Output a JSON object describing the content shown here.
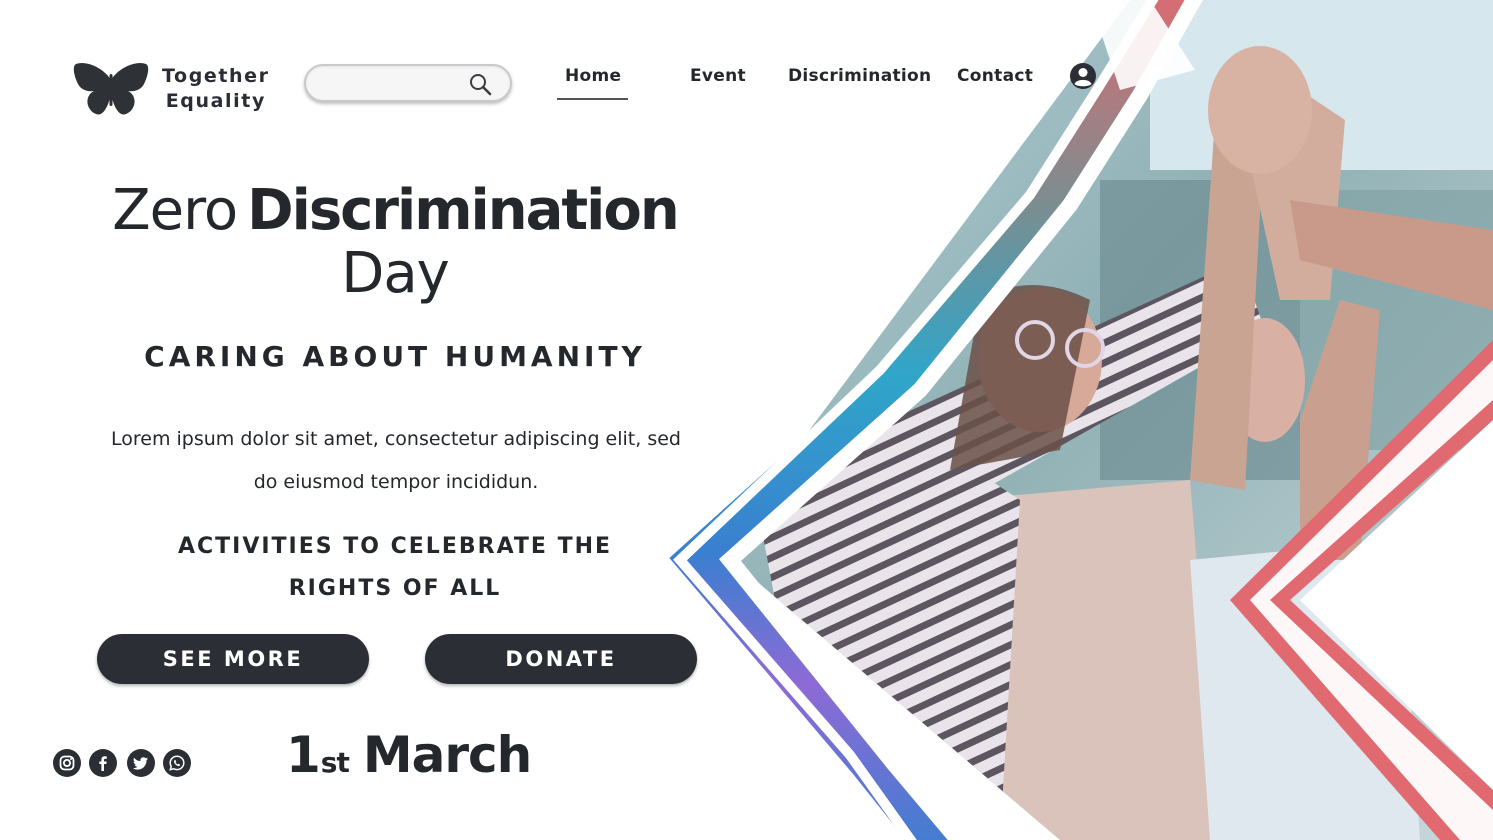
{
  "brand": {
    "line1": "Together",
    "line2": "Equality",
    "logo_icon": "butterfly-icon"
  },
  "search": {
    "placeholder": "",
    "value": "",
    "icon": "search-icon"
  },
  "nav": {
    "items": [
      {
        "label": "Home",
        "active": true
      },
      {
        "label": "Event",
        "active": false
      },
      {
        "label": "Discrimination",
        "active": false
      },
      {
        "label": "Contact",
        "active": false
      }
    ],
    "account_icon": "user-icon"
  },
  "hero": {
    "title_light": "Zero",
    "title_bold": "Discrimination",
    "title_line2": "Day",
    "tagline": "CARING ABOUT HUMANITY",
    "body_line1": "Lorem ipsum dolor sit amet, consectetur adipiscing elit, sed",
    "body_line2": "do eiusmod tempor incididun.",
    "activities_line1": "ACTIVITIES TO CELEBRATE THE",
    "activities_line2": "RIGHTS OF ALL"
  },
  "buttons": {
    "see_more": "SEE MORE",
    "donate": "DONATE"
  },
  "social": [
    "instagram-icon",
    "facebook-icon",
    "twitter-icon",
    "whatsapp-icon"
  ],
  "date": {
    "day": "1",
    "suffix": "st",
    "month": "March"
  },
  "image": {
    "subject": "people-high-five-photo"
  },
  "colors": {
    "text_dark": "#24272c",
    "button_bg": "#2b2f35",
    "frame_red": "#e06a70",
    "frame_blue": "#3a7fd0",
    "frame_purple": "#8e6ad6"
  }
}
